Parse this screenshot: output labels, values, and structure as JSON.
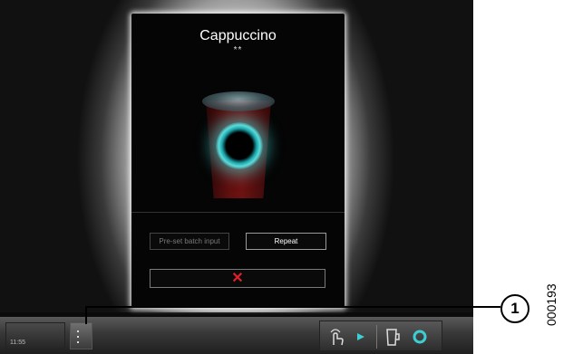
{
  "dialog": {
    "title": "Cappuccino",
    "subtitle": "**",
    "preset_label": "Pre-set batch input",
    "repeat_label": "Repeat",
    "cancel_glyph": "✕"
  },
  "taskbar": {
    "time": "11:55"
  },
  "annotation": {
    "callout_number": "1",
    "doc_number": "000193"
  },
  "colors": {
    "accent_cyan": "#3ccfd4",
    "cancel_red": "#e0202a",
    "cup_red": "#6a1010"
  },
  "icons": {
    "touch": "hand-touch-icon",
    "arrow": "play-arrow-icon",
    "cup": "cup-outline-icon",
    "ring": "ring-icon"
  }
}
